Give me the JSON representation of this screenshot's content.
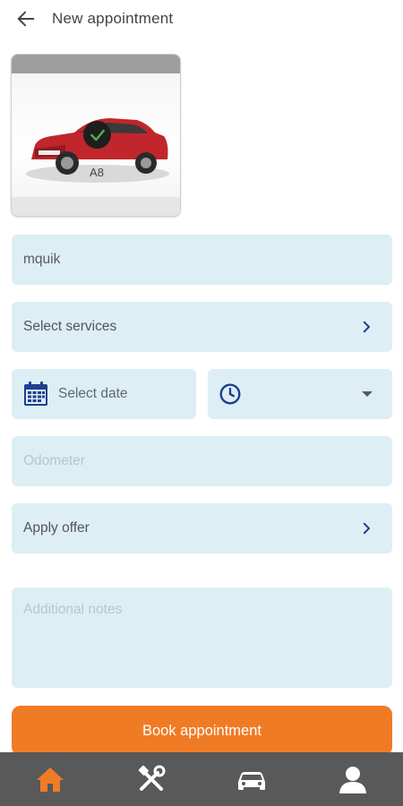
{
  "header": {
    "title": "New appointment",
    "back_icon": "arrow-left-icon"
  },
  "vehicle": {
    "model": "A8",
    "selected": true,
    "car_color": "#c0262c"
  },
  "form": {
    "customer_value": "mquik",
    "services_label": "Select services",
    "date_placeholder": "Select date",
    "time_value": "",
    "odometer_placeholder": "Odometer",
    "offer_label": "Apply offer",
    "notes_placeholder": "Additional notes"
  },
  "actions": {
    "book_label": "Book appointment"
  },
  "colors": {
    "accent": "#f07b25",
    "field_bg": "#ddeef5",
    "icon_blue": "#1f3f8f",
    "nav_bg": "#595959"
  },
  "nav": {
    "items": [
      {
        "icon": "home-icon",
        "active": true
      },
      {
        "icon": "tools-icon",
        "active": false
      },
      {
        "icon": "car-icon",
        "active": false
      },
      {
        "icon": "user-icon",
        "active": false
      }
    ]
  }
}
